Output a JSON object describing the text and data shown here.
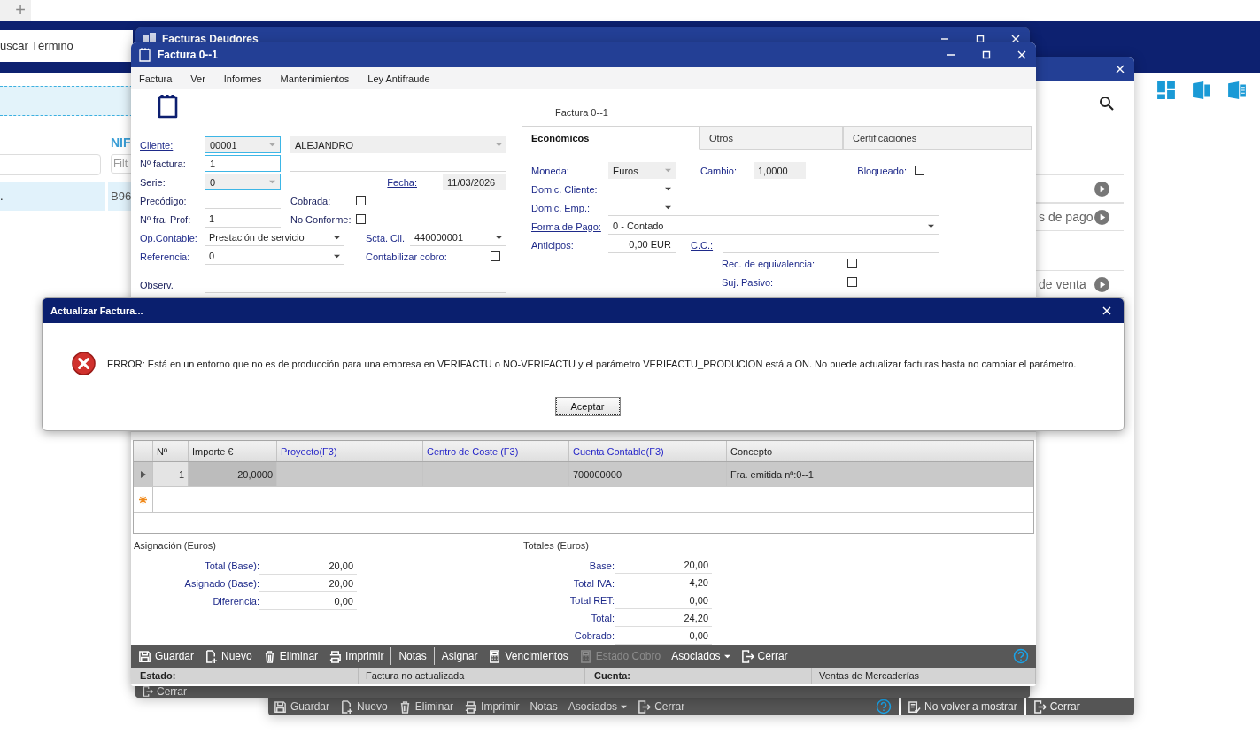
{
  "browser": {
    "new_tab": "+"
  },
  "background_app": {
    "search_label": "uscar Término",
    "column_header": "NIF",
    "filter_placeholder": "Filt",
    "row_cells": [
      ".",
      "B96"
    ]
  },
  "side_window": {
    "list_items": [
      {
        "label": "s de pago"
      },
      {
        "label": "de venta"
      }
    ],
    "toolbar": [
      {
        "label": "Guardar",
        "kind": "save"
      },
      {
        "label": "Nuevo",
        "kind": "new"
      },
      {
        "label": "Eliminar",
        "kind": "delete"
      },
      {
        "label": "Imprimir",
        "kind": "print"
      },
      {
        "label": "Notas",
        "kind": "text"
      },
      {
        "label": "Asociados",
        "kind": "menu"
      },
      {
        "label": "Cerrar",
        "kind": "exit"
      }
    ],
    "extra_buttons": [
      {
        "label": "No volver a mostrar",
        "kind": "checklist"
      },
      {
        "label": "Cerrar",
        "kind": "exit"
      }
    ]
  },
  "list_window": {
    "title": "Facturas Deudores",
    "toolbar": [
      {
        "label": "Cerrar",
        "kind": "exit"
      }
    ]
  },
  "invoice_window": {
    "title": "Factura 0--1",
    "menu": [
      "Factura",
      "Ver",
      "Informes",
      "Mantenimientos",
      "Ley Antifraude"
    ],
    "heading": "Factura 0--1",
    "form": {
      "cliente": {
        "label": "Cliente:",
        "code": "00001",
        "name": "ALEJANDRO"
      },
      "numero": {
        "label": "Nº factura:",
        "value": "1"
      },
      "serie": {
        "label": "Serie:",
        "value": "0"
      },
      "fecha": {
        "label": "Fecha:",
        "value": "11/03/2026"
      },
      "precodigo": {
        "label": "Precódigo:"
      },
      "cobrada": {
        "label": "Cobrada:",
        "checked": false
      },
      "prof": {
        "label": "Nº fra. Prof:",
        "value": "1"
      },
      "no_conforme": {
        "label": "No Conforme:",
        "checked": false
      },
      "op_contable": {
        "label": "Op.Contable:",
        "value": "Prestación de servicio"
      },
      "scta": {
        "label": "Scta. Cli.",
        "value": "440000001"
      },
      "referencia": {
        "label": "Referencia:",
        "value": "0"
      },
      "contabilizar": {
        "label": "Contabilizar cobro:",
        "checked": false
      },
      "observ": {
        "label": "Observ."
      }
    },
    "tabs": [
      {
        "label": "Económicos",
        "selected": true
      },
      {
        "label": "Otros",
        "selected": false
      },
      {
        "label": "Certificaciones",
        "selected": false
      }
    ],
    "economicos": {
      "moneda": {
        "label": "Moneda:",
        "value": "Euros"
      },
      "cambio": {
        "label": "Cambio:",
        "value": "1,0000"
      },
      "bloqueado": {
        "label": "Bloqueado:",
        "checked": false
      },
      "domic_cliente": {
        "label": "Domic. Cliente:"
      },
      "domic_emp": {
        "label": "Domic. Emp.:"
      },
      "forma_pago": {
        "label": "Forma de Pago:",
        "value": "0 - Contado"
      },
      "anticipos": {
        "label": "Anticipos:",
        "value": "0,00 EUR"
      },
      "cc": {
        "label": "C.C.:"
      },
      "rec_equivalencia": {
        "label": "Rec. de equivalencia:",
        "checked": false
      },
      "suj_pasivo": {
        "label": "Suj. Pasivo:",
        "checked": false
      }
    },
    "grid": {
      "columns": [
        {
          "label": "Nº",
          "kind": "plain"
        },
        {
          "label": "Importe €",
          "kind": "plain"
        },
        {
          "label": "Proyecto(F3)",
          "kind": "lookup"
        },
        {
          "label": "Centro de Coste (F3)",
          "kind": "lookup"
        },
        {
          "label": "Cuenta Contable(F3)",
          "kind": "lookup"
        },
        {
          "label": "Concepto",
          "kind": "plain"
        }
      ],
      "rows": [
        {
          "numero": "1",
          "importe": "20,0000",
          "cuenta": "700000000",
          "concepto": "Fra. emitida nº:0--1",
          "selected": true
        }
      ]
    },
    "asignacion": {
      "title": "Asignación (Euros)",
      "rows": [
        {
          "label": "Total (Base):",
          "value": "20,00"
        },
        {
          "label": "Asignado (Base):",
          "value": "20,00"
        },
        {
          "label": "Diferencia:",
          "value": "0,00"
        }
      ]
    },
    "totales": {
      "title": "Totales (Euros)",
      "rows": [
        {
          "label": "Base:",
          "value": "20,00"
        },
        {
          "label": "Total IVA:",
          "value": "4,20"
        },
        {
          "label": "Total RET:",
          "value": "0,00"
        },
        {
          "label": "Total:",
          "value": "24,20"
        },
        {
          "label": "Cobrado:",
          "value": "0,00"
        }
      ]
    },
    "toolbar": [
      {
        "label": "Guardar",
        "kind": "save"
      },
      {
        "label": "Nuevo",
        "kind": "new"
      },
      {
        "label": "Eliminar",
        "kind": "delete"
      },
      {
        "label": "Imprimir",
        "kind": "print"
      },
      {
        "label": "Notas",
        "kind": "text",
        "separator_before": true
      },
      {
        "label": "Asignar",
        "kind": "text",
        "separator_before": true
      },
      {
        "label": "Vencimientos",
        "kind": "calc"
      },
      {
        "label": "Estado Cobro",
        "kind": "calc",
        "disabled": true
      },
      {
        "label": "Asociados",
        "kind": "menu"
      },
      {
        "label": "Cerrar",
        "kind": "exit"
      }
    ],
    "status_bar": [
      {
        "label": "Estado:",
        "value": "Factura no actualizada"
      },
      {
        "label": "Cuenta:",
        "value": "Ventas de Mercaderías"
      }
    ]
  },
  "dialog": {
    "title": "Actualizar Factura...",
    "message": "ERROR: Está en un entorno que no es de producción para una empresa en VERIFACTU o NO-VERIFACTU y el parámetro VERIFACTU_PRODUCION está a ON. No puede actualizar facturas hasta no cambiar el parámetro.",
    "button": "Aceptar"
  }
}
